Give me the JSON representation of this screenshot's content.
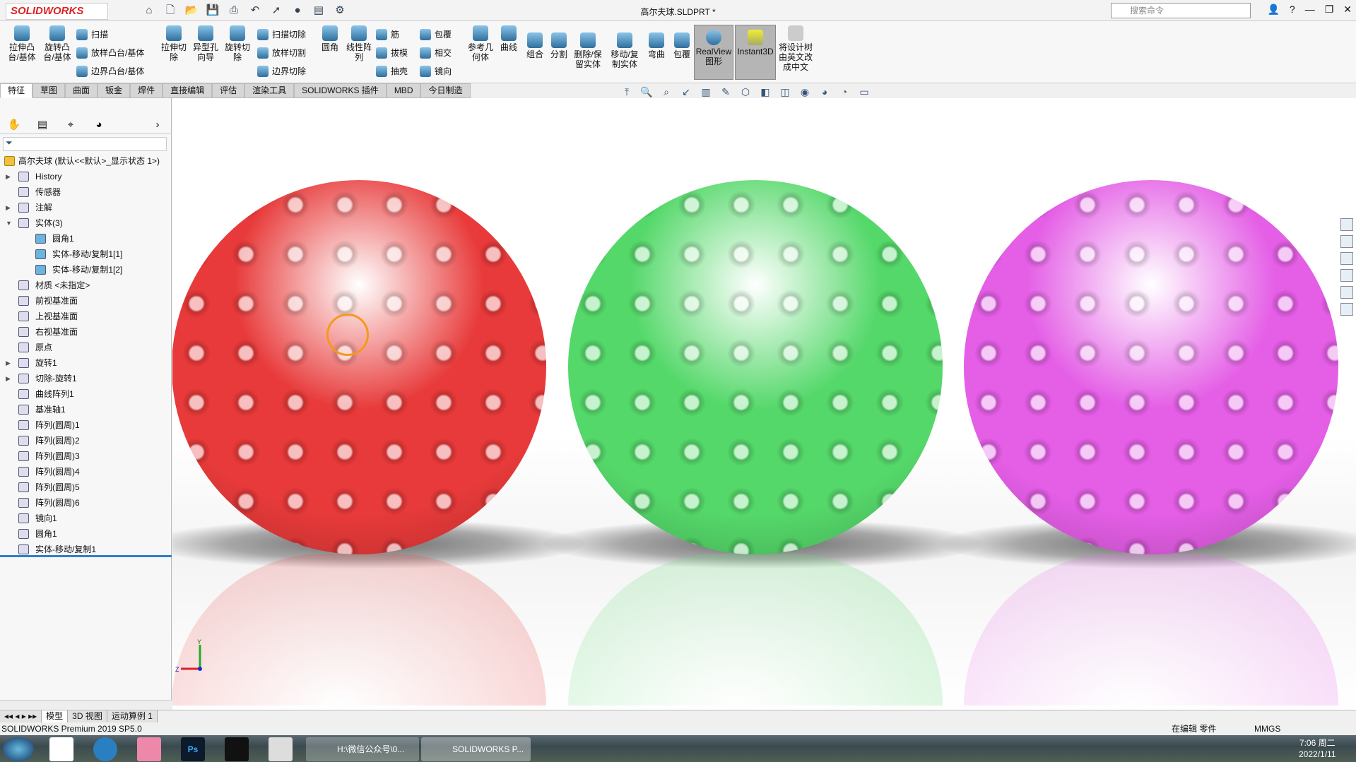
{
  "app": {
    "logo": "SOLIDWORKS",
    "document_title": "高尔夫球.SLDPRT *",
    "search_placeholder": "搜索命令",
    "window_buttons": [
      "—",
      "❐",
      "✕"
    ]
  },
  "ribbon": {
    "large": [
      {
        "label": "拉伸凸台/基体"
      },
      {
        "label": "旋转凸台/基体"
      },
      {
        "label": "拉伸切除"
      },
      {
        "label": "异型孔向导"
      },
      {
        "label": "旋转切除"
      },
      {
        "label": "圆角"
      },
      {
        "label": "线性阵列"
      },
      {
        "label": "参考几何体"
      },
      {
        "label": "曲线"
      },
      {
        "label": "组合"
      },
      {
        "label": "分割"
      },
      {
        "label": "删除/保留实体"
      },
      {
        "label": "移动/复制实体"
      },
      {
        "label": "弯曲"
      },
      {
        "label": "包覆"
      },
      {
        "label": "RealView图形"
      },
      {
        "label": "Instant3D"
      },
      {
        "label": "将设计树由英文改成中文"
      }
    ],
    "small": [
      {
        "label": "扫描"
      },
      {
        "label": "放样凸台/基体"
      },
      {
        "label": "边界凸台/基体"
      },
      {
        "label": "扫描切除"
      },
      {
        "label": "放样切割"
      },
      {
        "label": "边界切除"
      },
      {
        "label": "筋"
      },
      {
        "label": "拔模"
      },
      {
        "label": "抽壳"
      },
      {
        "label": "包覆"
      },
      {
        "label": "相交"
      },
      {
        "label": "镜向"
      }
    ]
  },
  "command_tabs": [
    "特征",
    "草图",
    "曲面",
    "钣金",
    "焊件",
    "直接编辑",
    "评估",
    "渲染工具",
    "SOLIDWORKS 插件",
    "MBD",
    "今日制造"
  ],
  "tree": {
    "root": "高尔夫球  (默认<<默认>_显示状态 1>)",
    "items": [
      {
        "label": "History",
        "level": 1,
        "expand": "right"
      },
      {
        "label": "传感器",
        "level": 1
      },
      {
        "label": "注解",
        "level": 1,
        "expand": "right"
      },
      {
        "label": "实体(3)",
        "level": 1,
        "expand": "down"
      },
      {
        "label": "圆角1",
        "level": 2
      },
      {
        "label": "实体-移动/复制1[1]",
        "level": 2
      },
      {
        "label": "实体-移动/复制1[2]",
        "level": 2
      },
      {
        "label": "材质 <未指定>",
        "level": 1
      },
      {
        "label": "前视基准面",
        "level": 1
      },
      {
        "label": "上视基准面",
        "level": 1
      },
      {
        "label": "右视基准面",
        "level": 1
      },
      {
        "label": "原点",
        "level": 1
      },
      {
        "label": "旋转1",
        "level": 1,
        "expand": "right"
      },
      {
        "label": "切除-旋转1",
        "level": 1,
        "expand": "right"
      },
      {
        "label": "曲线阵列1",
        "level": 1
      },
      {
        "label": "基准轴1",
        "level": 1
      },
      {
        "label": "阵列(圆周)1",
        "level": 1
      },
      {
        "label": "阵列(圆周)2",
        "level": 1
      },
      {
        "label": "阵列(圆周)3",
        "level": 1
      },
      {
        "label": "阵列(圆周)4",
        "level": 1
      },
      {
        "label": "阵列(圆周)5",
        "level": 1
      },
      {
        "label": "阵列(圆周)6",
        "level": 1
      },
      {
        "label": "镜向1",
        "level": 1
      },
      {
        "label": "圆角1",
        "level": 1
      },
      {
        "label": "实体-移动/复制1",
        "level": 1
      }
    ]
  },
  "balls": [
    {
      "color": "#e83a3a"
    },
    {
      "color": "#55d86a"
    },
    {
      "color": "#e45ee6"
    }
  ],
  "bottom_tabs": [
    "模型",
    "3D 视图",
    "运动算例 1"
  ],
  "status": {
    "left": "SOLIDWORKS Premium 2019 SP5.0",
    "mode": "在编辑 零件",
    "units": "MMGS"
  },
  "taskbar": {
    "windows": [
      "H:\\微信公众号\\0...",
      "SOLIDWORKS P..."
    ],
    "time": "7:06 周二",
    "date": "2022/1/11"
  },
  "triad": {
    "z": "Z",
    "y": "Y"
  }
}
